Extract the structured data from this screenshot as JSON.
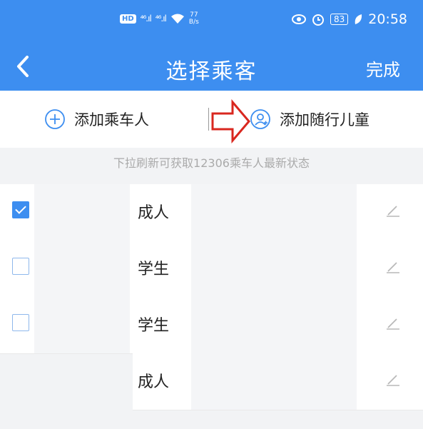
{
  "status_bar": {
    "hd": "HD",
    "signal1": "⁴⁶.ıl",
    "signal2": "⁴⁶.ıl",
    "speed_value": "77",
    "speed_unit": "B/s",
    "battery": "83",
    "time": "20:58"
  },
  "nav": {
    "title": "选择乘客",
    "done_label": "完成",
    "back_icon": "chevron-left-icon"
  },
  "actions": {
    "add_passenger": "添加乘车人",
    "add_child": "添加随行儿童"
  },
  "hint": "下拉刷新可获取12306乘车人最新状态",
  "passengers": [
    {
      "type": "成人",
      "checked": true
    },
    {
      "type": "学生",
      "checked": false
    },
    {
      "type": "学生",
      "checked": false
    },
    {
      "type": "成人",
      "checked": false
    }
  ],
  "colors": {
    "accent": "#3d8ef0",
    "annotation_arrow": "#d9271f"
  }
}
